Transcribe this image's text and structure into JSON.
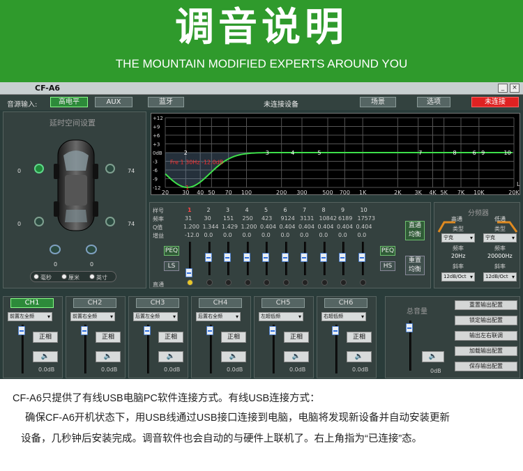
{
  "banner": {
    "title": "调音说明",
    "subtitle": "THE MOUNTAIN MODIFIED EXPERTS AROUND YOU",
    "color": "#2f9a2c"
  },
  "window": {
    "title": "CF-A6",
    "minimize": "_",
    "close": "×"
  },
  "toolbar": {
    "input_label": "音源输入:",
    "inputs": [
      "高电平",
      "AUX",
      "蓝牙"
    ],
    "status": "未连接设备",
    "scene": "场景",
    "options": "选项",
    "connect": "未连接"
  },
  "delay": {
    "title": "延时空间设置",
    "left_values": [
      "0",
      "0"
    ],
    "right_values": [
      "74",
      "74"
    ],
    "sub_values": [
      "0",
      "0"
    ],
    "units": [
      "毫秒",
      "厘米",
      "英寸"
    ]
  },
  "graph": {
    "y_ticks": [
      "+12",
      "+9",
      "+6",
      "+3",
      "0dB",
      "-3",
      "-6",
      "-9",
      "-12"
    ],
    "x_ticks": [
      "20",
      "30",
      "40",
      "50",
      "70",
      "100",
      "200",
      "300",
      "500",
      "700",
      "1K",
      "2K",
      "3K",
      "4K",
      "5K",
      "7K",
      "10K",
      "20K"
    ],
    "marker_points": [
      "1",
      "2",
      "3",
      "4",
      "5",
      "7",
      "8",
      "6",
      "9",
      "10"
    ],
    "readout": "Fre 1 30Hz -12.0dB",
    "axis_label": "L"
  },
  "eq": {
    "row_labels": [
      "样号",
      "频率",
      "Q值",
      "增益"
    ],
    "bands": [
      "1",
      "2",
      "3",
      "4",
      "5",
      "6",
      "7",
      "8",
      "9",
      "10"
    ],
    "freq": [
      "31",
      "30",
      "151",
      "250",
      "423",
      "9124",
      "3131",
      "10842",
      "6189",
      "17573"
    ],
    "q": [
      "1.200",
      "1.344",
      "1.429",
      "1.200",
      "0.404",
      "0.404",
      "0.404",
      "0.404",
      "0.404",
      "0.404"
    ],
    "gain": [
      "-12.0",
      "0.0",
      "0.0",
      "0.0",
      "0.0",
      "0.0",
      "0.0",
      "0.0",
      "0.0",
      "0.0"
    ],
    "peq_left": "PEQ",
    "ls": "LS",
    "peq_right": "PEQ",
    "hs": "HS",
    "direct": "直通",
    "direct_eq": "直通均衡",
    "reset_eq": "重置均衡"
  },
  "crossover": {
    "title": "分频器",
    "high": {
      "title": "高通",
      "type_label": "类型",
      "type": "宁克",
      "freq_label": "频率",
      "freq": "20Hz",
      "slope_label": "斜率",
      "slope": "12dB/Oct"
    },
    "low": {
      "title": "低通",
      "type_label": "类型",
      "type": "宁克",
      "freq_label": "频率",
      "freq": "20000Hz",
      "slope_label": "斜率",
      "slope": "12dB/Oct"
    }
  },
  "channels": [
    {
      "name": "CH1",
      "output": "前置左全频",
      "phase": "正相",
      "level": "0.0dB"
    },
    {
      "name": "CH2",
      "output": "前置右全频",
      "phase": "正相",
      "level": "0.0dB"
    },
    {
      "name": "CH3",
      "output": "后置左全频",
      "phase": "正相",
      "level": "0.0dB"
    },
    {
      "name": "CH4",
      "output": "后置右全频",
      "phase": "正相",
      "level": "0.0dB"
    },
    {
      "name": "CH5",
      "output": "左超低频",
      "phase": "正相",
      "level": "0.0dB"
    },
    {
      "name": "CH6",
      "output": "右超低频",
      "phase": "正相",
      "level": "0.0dB"
    }
  ],
  "master": {
    "title": "总音量",
    "level": "0dB"
  },
  "output_buttons": [
    "重置输出配置",
    "锁定输出配置",
    "输出左右联调",
    "加载输出配置",
    "保存输出配置"
  ],
  "caption": {
    "line1": "CF-A6只提供了有线USB电脑PC软件连接方式。有线USB连接方式：",
    "line2": "确保CF-A6开机状态下，用USB线通过USB接口连接到电脑，电脑将发现新设备并自动安装更新",
    "line3": "设备，几秒钟后安装完成。调音软件也会自动的与硬件上联机了。右上角指为“已连接”态。"
  }
}
